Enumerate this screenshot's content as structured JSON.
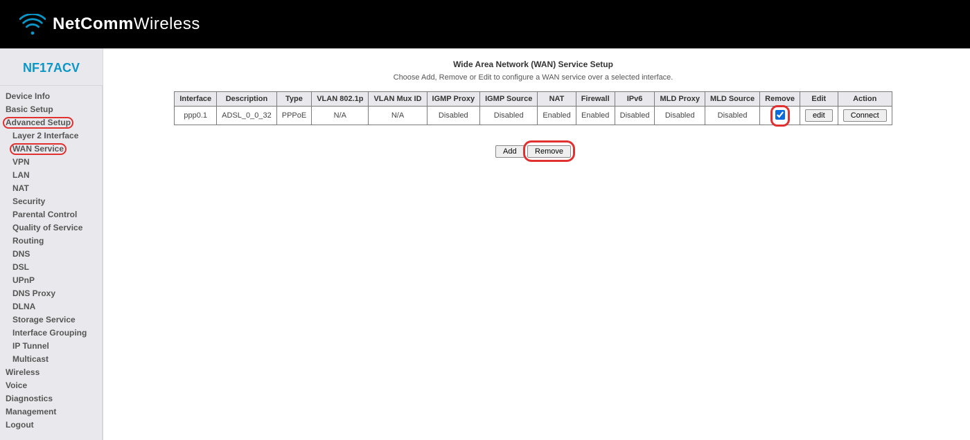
{
  "brand": {
    "name1": "NetComm",
    "name2": "Wireless",
    "model": "NF17ACV"
  },
  "nav": {
    "device_info": "Device Info",
    "basic_setup": "Basic Setup",
    "advanced_setup": "Advanced Setup",
    "layer2": "Layer 2 Interface",
    "wan_service": "WAN Service",
    "vpn": "VPN",
    "lan": "LAN",
    "nat": "NAT",
    "security": "Security",
    "parental": "Parental Control",
    "qos": "Quality of Service",
    "routing": "Routing",
    "dns": "DNS",
    "dsl": "DSL",
    "upnp": "UPnP",
    "dns_proxy": "DNS Proxy",
    "dlna": "DLNA",
    "storage": "Storage Service",
    "if_group": "Interface Grouping",
    "ip_tunnel": "IP Tunnel",
    "multicast": "Multicast",
    "wireless": "Wireless",
    "voice": "Voice",
    "diagnostics": "Diagnostics",
    "management": "Management",
    "logout": "Logout"
  },
  "page": {
    "title": "Wide Area Network (WAN) Service Setup",
    "subtitle": "Choose Add, Remove or Edit to configure a WAN service over a selected interface."
  },
  "table": {
    "headers": {
      "iface": "Interface",
      "desc": "Description",
      "type": "Type",
      "vlan8021p": "VLAN 802.1p",
      "vlanmux": "VLAN Mux ID",
      "igmpproxy": "IGMP Proxy",
      "igmpsrc": "IGMP Source",
      "nat": "NAT",
      "firewall": "Firewall",
      "ipv6": "IPv6",
      "mldproxy": "MLD Proxy",
      "mldsrc": "MLD Source",
      "remove": "Remove",
      "edit": "Edit",
      "action": "Action"
    },
    "rows": [
      {
        "iface": "ppp0.1",
        "desc": "ADSL_0_0_32",
        "type": "PPPoE",
        "vlan8021p": "N/A",
        "vlanmux": "N/A",
        "igmpproxy": "Disabled",
        "igmpsrc": "Disabled",
        "nat": "Enabled",
        "firewall": "Enabled",
        "ipv6": "Disabled",
        "mldproxy": "Disabled",
        "mldsrc": "Disabled",
        "remove_checked": true,
        "edit_label": "edit",
        "action_label": "Connect"
      }
    ]
  },
  "buttons": {
    "add": "Add",
    "remove": "Remove"
  }
}
